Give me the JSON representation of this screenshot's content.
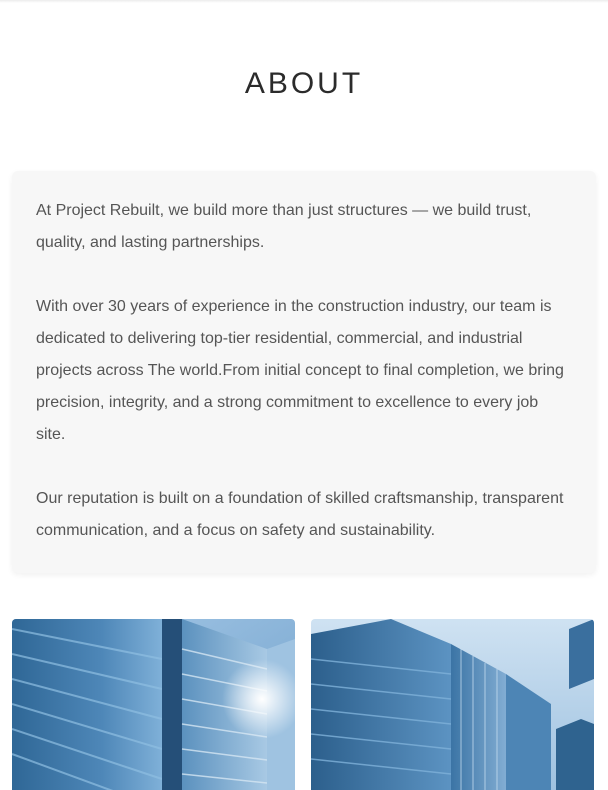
{
  "about": {
    "title": "ABOUT",
    "paragraphs": [
      "At Project Rebuilt, we build more than just structures — we build trust, quality, and lasting partnerships.",
      "With over 30 years of experience in the construction industry, our team is dedicated to delivering top-tier residential, commercial, and industrial projects across The world.From initial concept to final completion, we bring precision, integrity, and a strong commitment to excellence to every job site.",
      "Our reputation is built on a foundation of skilled craftsmanship, transparent communication, and a focus on safety and sustainability."
    ]
  },
  "colors": {
    "card_background": "#f7f7f7",
    "body_text": "#555555",
    "heading_text": "#2b2b2b",
    "sky_blue": "#8fb8dd",
    "glass_blue": "#3f79aa"
  }
}
